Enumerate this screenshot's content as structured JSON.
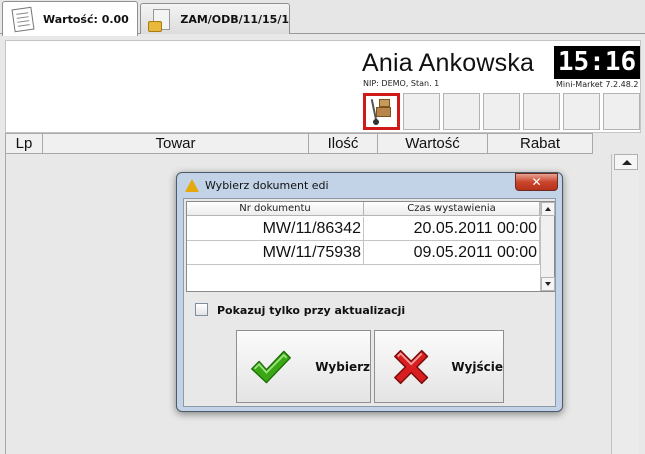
{
  "tabs": [
    {
      "label": "Wartość: 0.00",
      "icon": "receipt-icon",
      "active": true
    },
    {
      "label": "ZAM/ODB/11/15/1",
      "icon": "document-folder-icon",
      "active": false
    }
  ],
  "header": {
    "user_name": "Ania Ankowska",
    "nip_line": "NIP: DEMO, Stan. 1",
    "clock": "15:16",
    "version": "Mini-Market 7.2.48.2"
  },
  "quick_slots": {
    "selected_icon": "hand-truck-boxes-icon",
    "accent_color": "#d01919"
  },
  "grid": {
    "columns": [
      "Lp",
      "Towar",
      "Ilość",
      "Wartość",
      "Rabat"
    ]
  },
  "dialog": {
    "title": "Wybierz dokument edi",
    "close_label": "✕",
    "columns": [
      "Nr dokumentu",
      "Czas wystawienia"
    ],
    "rows": [
      {
        "number": "MW/11/86342",
        "time": "20.05.2011 00:00"
      },
      {
        "number": "MW/11/75938",
        "time": "09.05.2011 00:00"
      }
    ],
    "checkbox_label": "Pokazuj tylko przy aktualizacji",
    "checkbox_checked": false,
    "select_label": "Wybierz",
    "exit_label": "Wyjście",
    "colors": {
      "check_green": "#3aa814",
      "exit_red": "#d81e1e",
      "title_bg": "#c2d3e8"
    }
  }
}
